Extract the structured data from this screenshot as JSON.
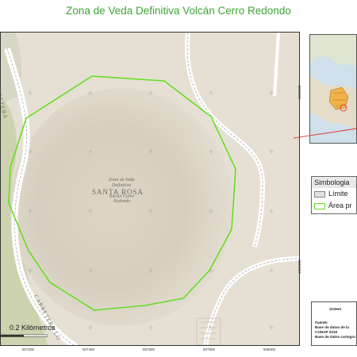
{
  "title": "Zona de Veda Definitiva Volcán Cerro Redondo",
  "coords_top": [
    "507200",
    "507400",
    "507600",
    "507800",
    "508000"
  ],
  "coords_bottom": [
    "507200",
    "507400",
    "507600",
    "507800",
    "508000"
  ],
  "coords_right": [
    "1566600",
    "1566400"
  ],
  "map_labels": {
    "place": "SANTA ROSA",
    "zone_line1": "Zona de Veda",
    "zone_line2": "Definitiva",
    "zone_line3": "Volcán Cerro",
    "zone_line4": "Redondo",
    "road_top": "CARRETERA",
    "road_bottom": "CARRETERA LO"
  },
  "legend": {
    "title": "Simbologia",
    "items": [
      {
        "label": "Límite",
        "color": "#e2e2e2"
      },
      {
        "label": "Área pr",
        "color": "#ffffff"
      }
    ]
  },
  "scale": {
    "label": "0.2 Kilómetros"
  },
  "info": {
    "heading": "Sistem",
    "fuente": "Fuente:",
    "line1": "Base de datos de la",
    "line2": "CONAP 2016",
    "line3": "Base de datos cartogra"
  },
  "colors": {
    "title": "#3fa535",
    "boundary": "#66dd22",
    "terrain": "#e6e0d4",
    "forest": "#c9d0a8"
  }
}
